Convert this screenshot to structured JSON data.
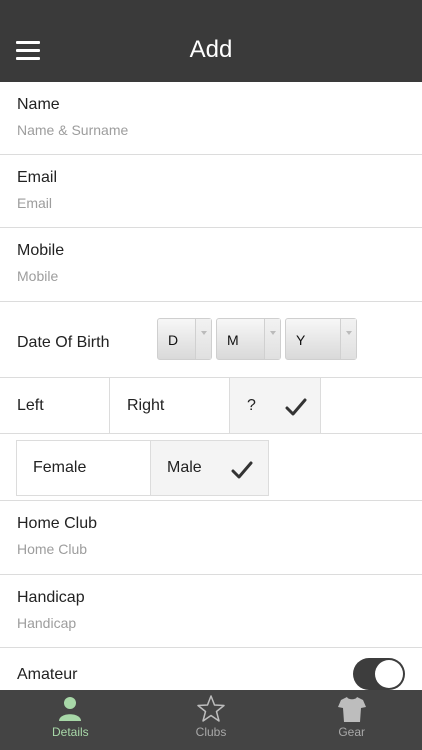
{
  "header": {
    "title": "Add"
  },
  "fields": {
    "name": {
      "label": "Name",
      "placeholder": "Name & Surname"
    },
    "email": {
      "label": "Email",
      "placeholder": "Email"
    },
    "mobile": {
      "label": "Mobile",
      "placeholder": "Mobile"
    },
    "home_club": {
      "label": "Home Club",
      "placeholder": "Home Club"
    },
    "handicap": {
      "label": "Handicap",
      "placeholder": "Handicap"
    }
  },
  "dob": {
    "label": "Date Of Birth",
    "day": "D",
    "month": "M",
    "year": "Y"
  },
  "handedness": {
    "left": "Left",
    "right": "Right",
    "unknown": "?",
    "selected": "unknown"
  },
  "gender": {
    "female": "Female",
    "male": "Male",
    "selected": "male"
  },
  "amateur": {
    "label": "Amateur",
    "on": true
  },
  "tabs": [
    {
      "label": "Details",
      "icon": "person-icon",
      "active": true
    },
    {
      "label": "Clubs",
      "icon": "star-icon",
      "active": false
    },
    {
      "label": "Gear",
      "icon": "shirt-icon",
      "active": false
    }
  ],
  "colors": {
    "nav": "#3a3a3a",
    "tabbar": "#444444",
    "active_tab": "#a8d8a8",
    "selected_bg": "#f4f4f4"
  }
}
